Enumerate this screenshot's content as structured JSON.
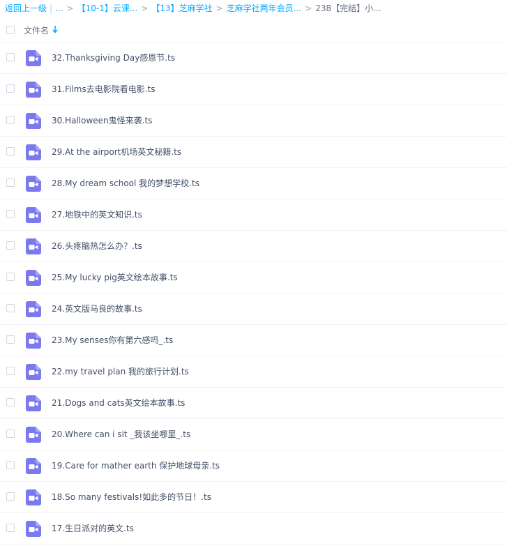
{
  "breadcrumb": {
    "back": "返回上一级",
    "ellipsis": "...",
    "items": [
      "【10-1】云课...",
      "【13】芝麻学社",
      "芝麻学社两年会员..."
    ],
    "current": "238【完结】小..."
  },
  "header": {
    "column_name": "文件名"
  },
  "files": [
    {
      "name": "32.Thanksgiving Day感恩节.ts"
    },
    {
      "name": "31.Films去电影院看电影.ts"
    },
    {
      "name": "30.Halloween鬼怪来袭.ts"
    },
    {
      "name": "29.At the airport机场英文秘籍.ts"
    },
    {
      "name": "28.My dream school 我的梦想学校.ts"
    },
    {
      "name": "27.地铁中的英文知识.ts"
    },
    {
      "name": "26.头疼脑热怎么办？.ts"
    },
    {
      "name": "25.My lucky pig英文绘本故事.ts"
    },
    {
      "name": "24.英文版马良的故事.ts"
    },
    {
      "name": "23.My senses你有第六感吗_.ts"
    },
    {
      "name": "22.my travel plan 我的旅行计划.ts"
    },
    {
      "name": "21.Dogs and cats英文绘本故事.ts"
    },
    {
      "name": "20.Where can i sit _我该坐哪里_.ts"
    },
    {
      "name": "19.Care for mather earth 保护地球母亲.ts"
    },
    {
      "name": "18.So many festivals!如此多的节日！.ts"
    },
    {
      "name": "17.生日派对的英文.ts"
    }
  ],
  "colors": {
    "link": "#09aaff",
    "video_icon": "#7b79ee",
    "text": "#424e67"
  },
  "icons": {
    "file_type": "video-file-icon",
    "sort": "sort-arrow-down-icon"
  }
}
